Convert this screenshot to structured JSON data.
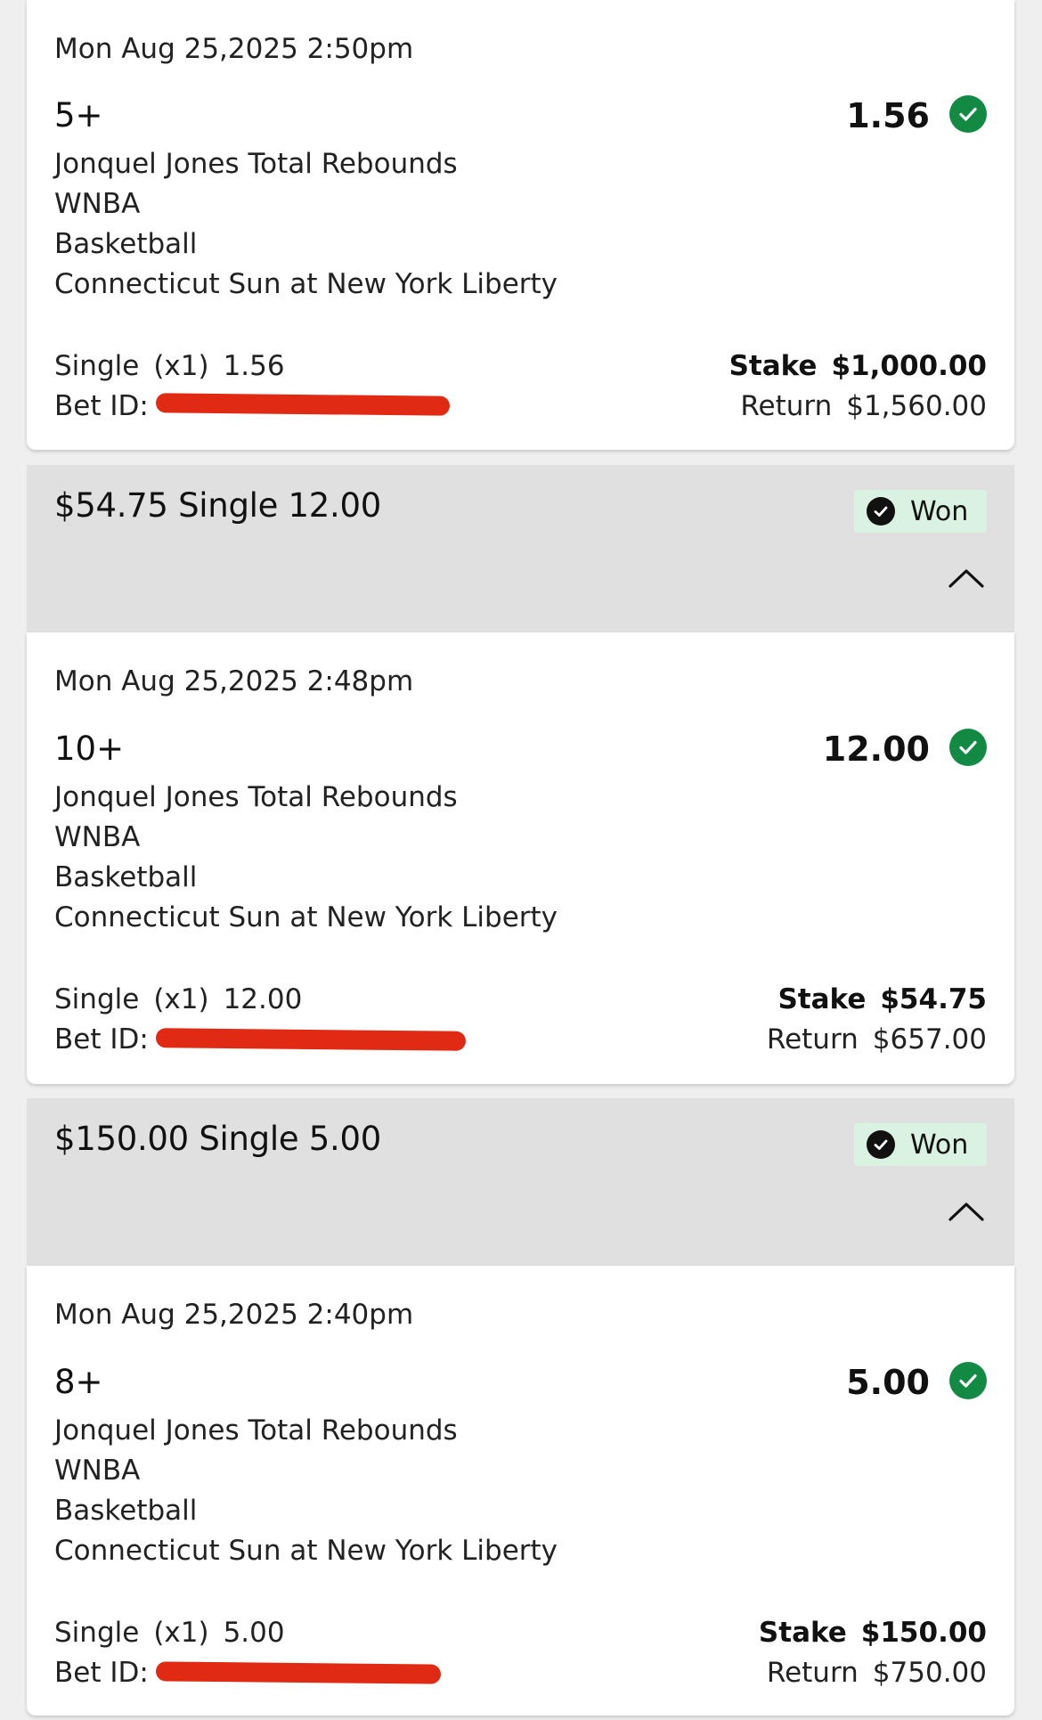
{
  "bets": [
    {
      "date": "Mon Aug 25,2025 2:50pm",
      "selection": "5+",
      "market": "Jonquel Jones Total Rebounds",
      "league": "WNBA",
      "sport": "Basketball",
      "event": "Connecticut Sun at New York Liberty",
      "odds": "1.56",
      "bet_type": "Single",
      "multiplier": "(x1)",
      "type_odds": "1.56",
      "bet_id_label": "Bet ID:",
      "stake_label": "Stake",
      "stake": "$1,000.00",
      "return_label": "Return",
      "return": "$1,560.00"
    },
    {
      "header_title": "$54.75 Single 12.00",
      "status": "Won",
      "date": "Mon Aug 25,2025 2:48pm",
      "selection": "10+",
      "market": "Jonquel Jones Total Rebounds",
      "league": "WNBA",
      "sport": "Basketball",
      "event": "Connecticut Sun at New York Liberty",
      "odds": "12.00",
      "bet_type": "Single",
      "multiplier": "(x1)",
      "type_odds": "12.00",
      "bet_id_label": "Bet ID:",
      "stake_label": "Stake",
      "stake": "$54.75",
      "return_label": "Return",
      "return": "$657.00"
    },
    {
      "header_title": "$150.00 Single 5.00",
      "status": "Won",
      "date": "Mon Aug 25,2025 2:40pm",
      "selection": "8+",
      "market": "Jonquel Jones Total Rebounds",
      "league": "WNBA",
      "sport": "Basketball",
      "event": "Connecticut Sun at New York Liberty",
      "odds": "5.00",
      "bet_type": "Single",
      "multiplier": "(x1)",
      "type_odds": "5.00",
      "bet_id_label": "Bet ID:",
      "stake_label": "Stake",
      "stake": "$150.00",
      "return_label": "Return",
      "return": "$750.00"
    }
  ],
  "icons": {
    "settled_check": "check-circle-icon",
    "won_check": "check-circle-icon",
    "collapse": "chevron-up-icon"
  },
  "colors": {
    "success_green": "#128a43",
    "won_badge_bg": "#d9f2e1",
    "header_bg": "#e0e0e0",
    "redaction": "#e02a14"
  }
}
